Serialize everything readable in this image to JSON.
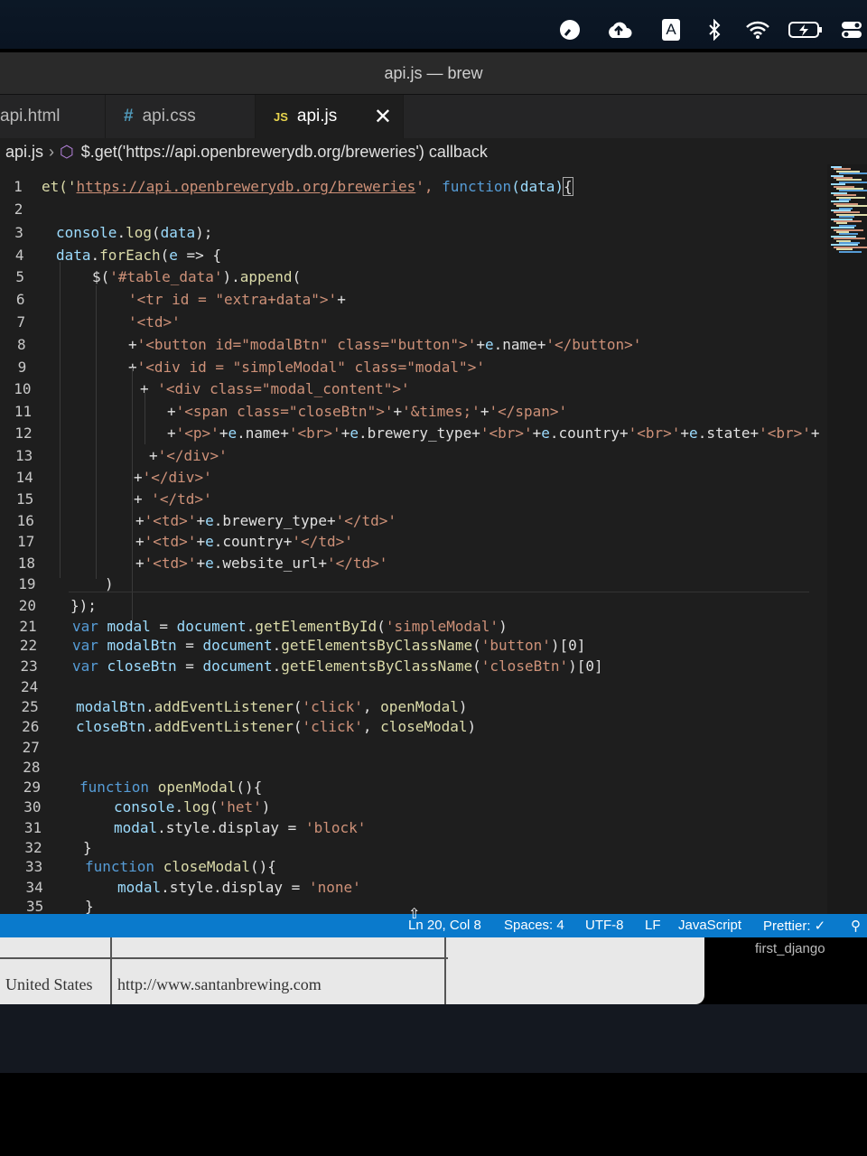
{
  "window": {
    "title": "api.js — brew"
  },
  "menubar": {
    "icons": [
      "speed-icon",
      "cloud-upload-icon",
      "keyboard-a-icon",
      "bluetooth-icon",
      "wifi-icon",
      "battery-icon",
      "control-center-icon"
    ],
    "keyboard_label": "A"
  },
  "tabs": [
    {
      "icon": "",
      "label": "api.html"
    },
    {
      "icon": "#",
      "label": "api.css"
    },
    {
      "icon": "JS",
      "label": "api.js"
    }
  ],
  "breadcrumb": {
    "file": "api.js",
    "symbol": "$.get('https://api.openbrewerydb.org/breweries') callback"
  },
  "code": {
    "l1_pre": "et('",
    "l1_url": "https://api.openbrewerydb.org/breweries",
    "l1_post": "', ",
    "l1_fn": "function",
    "l1_args": "(data)",
    "l1_brace": "{",
    "lines": [
      "console.log(data);",
      "data.forEach(e => {",
      "$('#table_data').append(",
      "'<tr id = \"extra+data\">'+",
      "'<td>'",
      "+'<button id=\"modalBtn\" class=\"button\">'+e.name+'</button>'",
      "+'<div id = \"simpleModal\" class=\"modal\">'",
      "+ '<div class=\"modal_content\">'",
      "+'<span class=\"closeBtn\">'+'&times;'+'</span>'",
      "+'<p>'+e.name+'<br>'+e.brewery_type+'<br>'+e.country+'<br>'+e.state+'<br>'+",
      "+'</div>'",
      "+'</div>'",
      "+ '</td>'",
      "+'<td>'+e.brewery_type+'</td>'",
      "+'<td>'+e.country+'</td>'",
      "+'<td>'+e.website_url+'</td>'",
      ")",
      "});",
      "var modal = document.getElementById('simpleModal')",
      "var modalBtn = document.getElementsByClassName('button')[0]",
      "var closeBtn = document.getElementsByClassName('closeBtn')[0]",
      "",
      "modalBtn.addEventListener('click', openModal)",
      "closeBtn.addEventListener('click', closeModal)",
      "",
      "",
      "function openModal(){",
      "console.log('het')",
      "modal.style.display = 'block'",
      "}",
      "function closeModal(){",
      "modal.style.display = 'none'",
      "}"
    ],
    "line_numbers": [
      "1",
      "2",
      "3",
      "4",
      "5",
      "6",
      "7",
      "8",
      "9",
      "10",
      "11",
      "12",
      "13",
      "14",
      "15",
      "16",
      "17",
      "18",
      "19",
      "20",
      "21",
      "22",
      "23",
      "24",
      "25",
      "26",
      "27",
      "28",
      "29",
      "30",
      "31",
      "32",
      "33",
      "34",
      "35"
    ]
  },
  "statusbar": {
    "position": "Ln 20, Col 8",
    "spaces": "Spaces: 4",
    "encoding": "UTF-8",
    "eol": "LF",
    "language": "JavaScript",
    "prettier": "Prettier: ✓"
  },
  "background_page": {
    "country": "United States",
    "website": "http://www.santanbrewing.com"
  },
  "dock_hint": "first_django",
  "colors": {
    "statusbar": "#0a7acc",
    "keyword": "#569cd6",
    "function": "#dcdcaa",
    "string": "#ce9178",
    "variable": "#9cdcfe"
  }
}
